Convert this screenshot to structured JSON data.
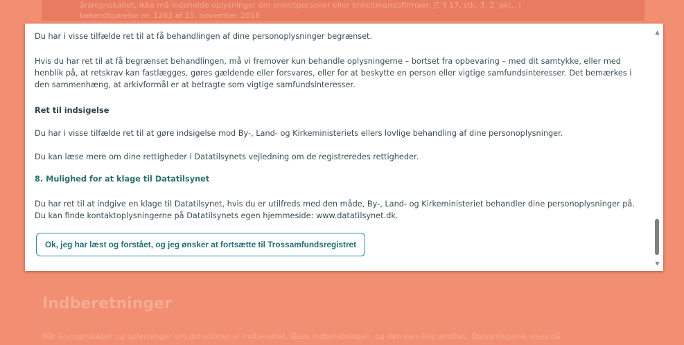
{
  "background": {
    "box_text": "årsregnskabet, ikke må indeholde oplysninger om enkeltpersoner eller enkeltmandsfirmaer, jf. § 17, stk. 3, 2. pkt., i",
    "box_text_2": "bekendtgørelse nr. 1283 af 15. november 2018",
    "heading": "Indberetninger",
    "paragraph": "Når årsregnskaber og oplysninger om donationer er indberettet, låses indberetningen, og den kan ikke ændres. Oplysningerne vises på"
  },
  "modal": {
    "p_restrict_right": "Du har i visse tilfælde ret til at få behandlingen af dine personoplysninger begrænset.",
    "p_restrict_detail": "Hvis du har ret til at få begrænset behandlingen, må vi fremover kun behandle oplysningerne – bortset fra opbevaring – med dit samtykke, eller med henblik på, at retskrav kan fastlægges, gøres gældende eller forsvares, eller for at beskytte en person eller vigtige samfundsinteresser. Det bemærkes i den sammenhæng, at arkivformål er at betragte som vigtige samfundsinteresser.",
    "heading_objection": "Ret til indsigelse",
    "p_objection": "Du har i visse tilfælde ret til at gøre indsigelse mod By-, Land- og Kirkeministeriets ellers lovlige behandling af dine personoplysninger.",
    "p_read_more": "Du kan læse mere om dine rettigheder i Datatilsynets vejledning om de registreredes rettigheder.",
    "heading_complaint": "8. Mulighed for at klage til Datatilsynet",
    "p_complaint": "Du har ret til at indgive en klage til Datatilsynet, hvis du er utilfreds med den måde, By-, Land- og Kirkeministeriet behandler dine personoplysninger på. Du kan finde kontaktoplysningerne på Datatilsynets egen hjemmeside: www.datatilsynet.dk.",
    "confirm_button": "Ok, jeg har læst og forstået, og jeg ønsker at fortsætte til Trossamfundsregistret"
  },
  "icons": {
    "scroll_up": "arrow-up-icon",
    "scroll_down": "arrow-down-icon"
  },
  "colors": {
    "background": "#f28e72",
    "accent": "#2e8c8c"
  }
}
